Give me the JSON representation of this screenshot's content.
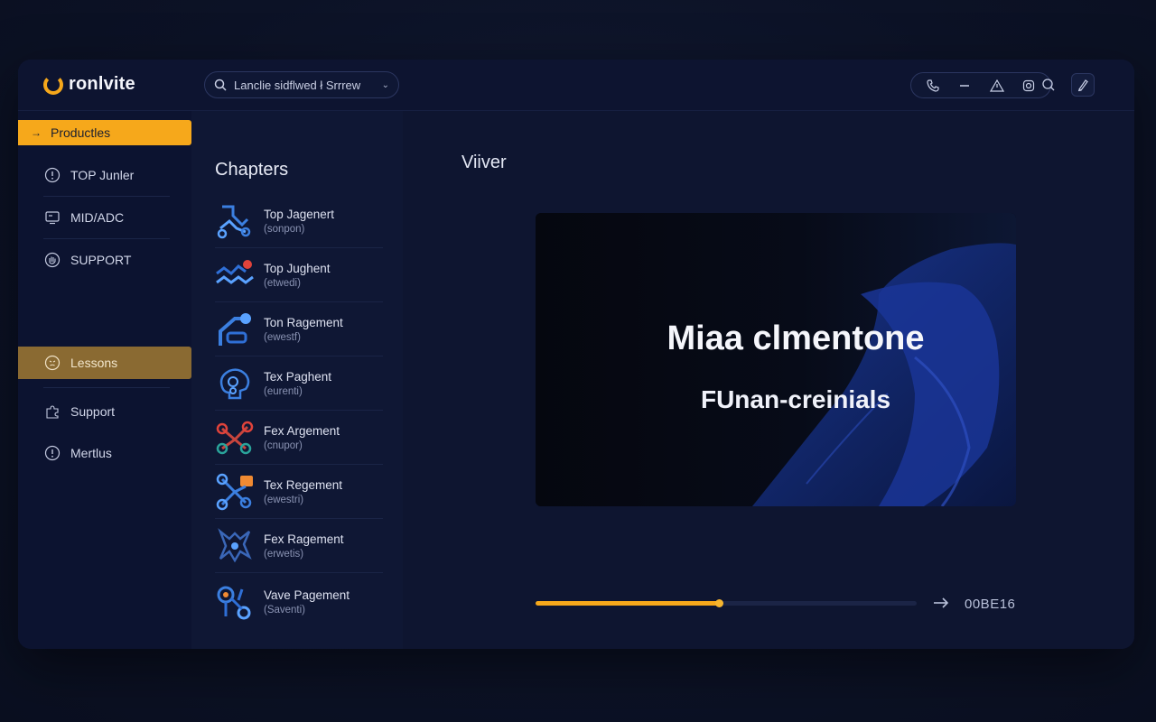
{
  "app": {
    "brand": "ronlvite"
  },
  "search": {
    "text": "Lanclie sidflwed ł Srrrew"
  },
  "sidebar": {
    "items": [
      {
        "label": "Productles",
        "icon": "arrow-right-icon",
        "state": "highlighted"
      },
      {
        "label": "TOP Junler",
        "icon": "info-icon",
        "state": "normal"
      },
      {
        "label": "MID/ADC",
        "icon": "monitor-icon",
        "state": "normal"
      },
      {
        "label": "SUPPORT",
        "icon": "hand-icon",
        "state": "normal"
      },
      {
        "label": "Lessons",
        "icon": "face-icon",
        "state": "selected"
      },
      {
        "label": "Support",
        "icon": "puzzle-icon",
        "state": "normal"
      },
      {
        "label": "Mertlus",
        "icon": "info-icon",
        "state": "normal"
      }
    ]
  },
  "chapters": {
    "title": "Chapters",
    "items": [
      {
        "title": "Top Jagenert",
        "subtitle": "(sonpon)",
        "icon": "route-icon"
      },
      {
        "title": "Top Jughent",
        "subtitle": "(etwedi)",
        "icon": "wave-icon"
      },
      {
        "title": "Ton Ragement",
        "subtitle": "(ewestf)",
        "icon": "arm-icon"
      },
      {
        "title": "Tex Paghent",
        "subtitle": "(eurenti)",
        "icon": "brain-icon"
      },
      {
        "title": "Fex Argement",
        "subtitle": "(cnupor)",
        "icon": "network-icon"
      },
      {
        "title": "Tex Regement",
        "subtitle": "(ewestri)",
        "icon": "flow-icon"
      },
      {
        "title": "Fex Ragement",
        "subtitle": "(erwetis)",
        "icon": "cross-icon"
      },
      {
        "title": "Vave Pagement",
        "subtitle": "(Saventi)",
        "icon": "link-icon"
      }
    ]
  },
  "viewer": {
    "title": "Viiver",
    "video": {
      "headline": "Miaa clmentone",
      "subtitle": "FUnan-creinials"
    },
    "progress": {
      "fraction": 0.48,
      "time": "00BE16"
    }
  },
  "colors": {
    "accent": "#f6a81b",
    "selected": "#8a6a32",
    "background": "#0e1530"
  }
}
